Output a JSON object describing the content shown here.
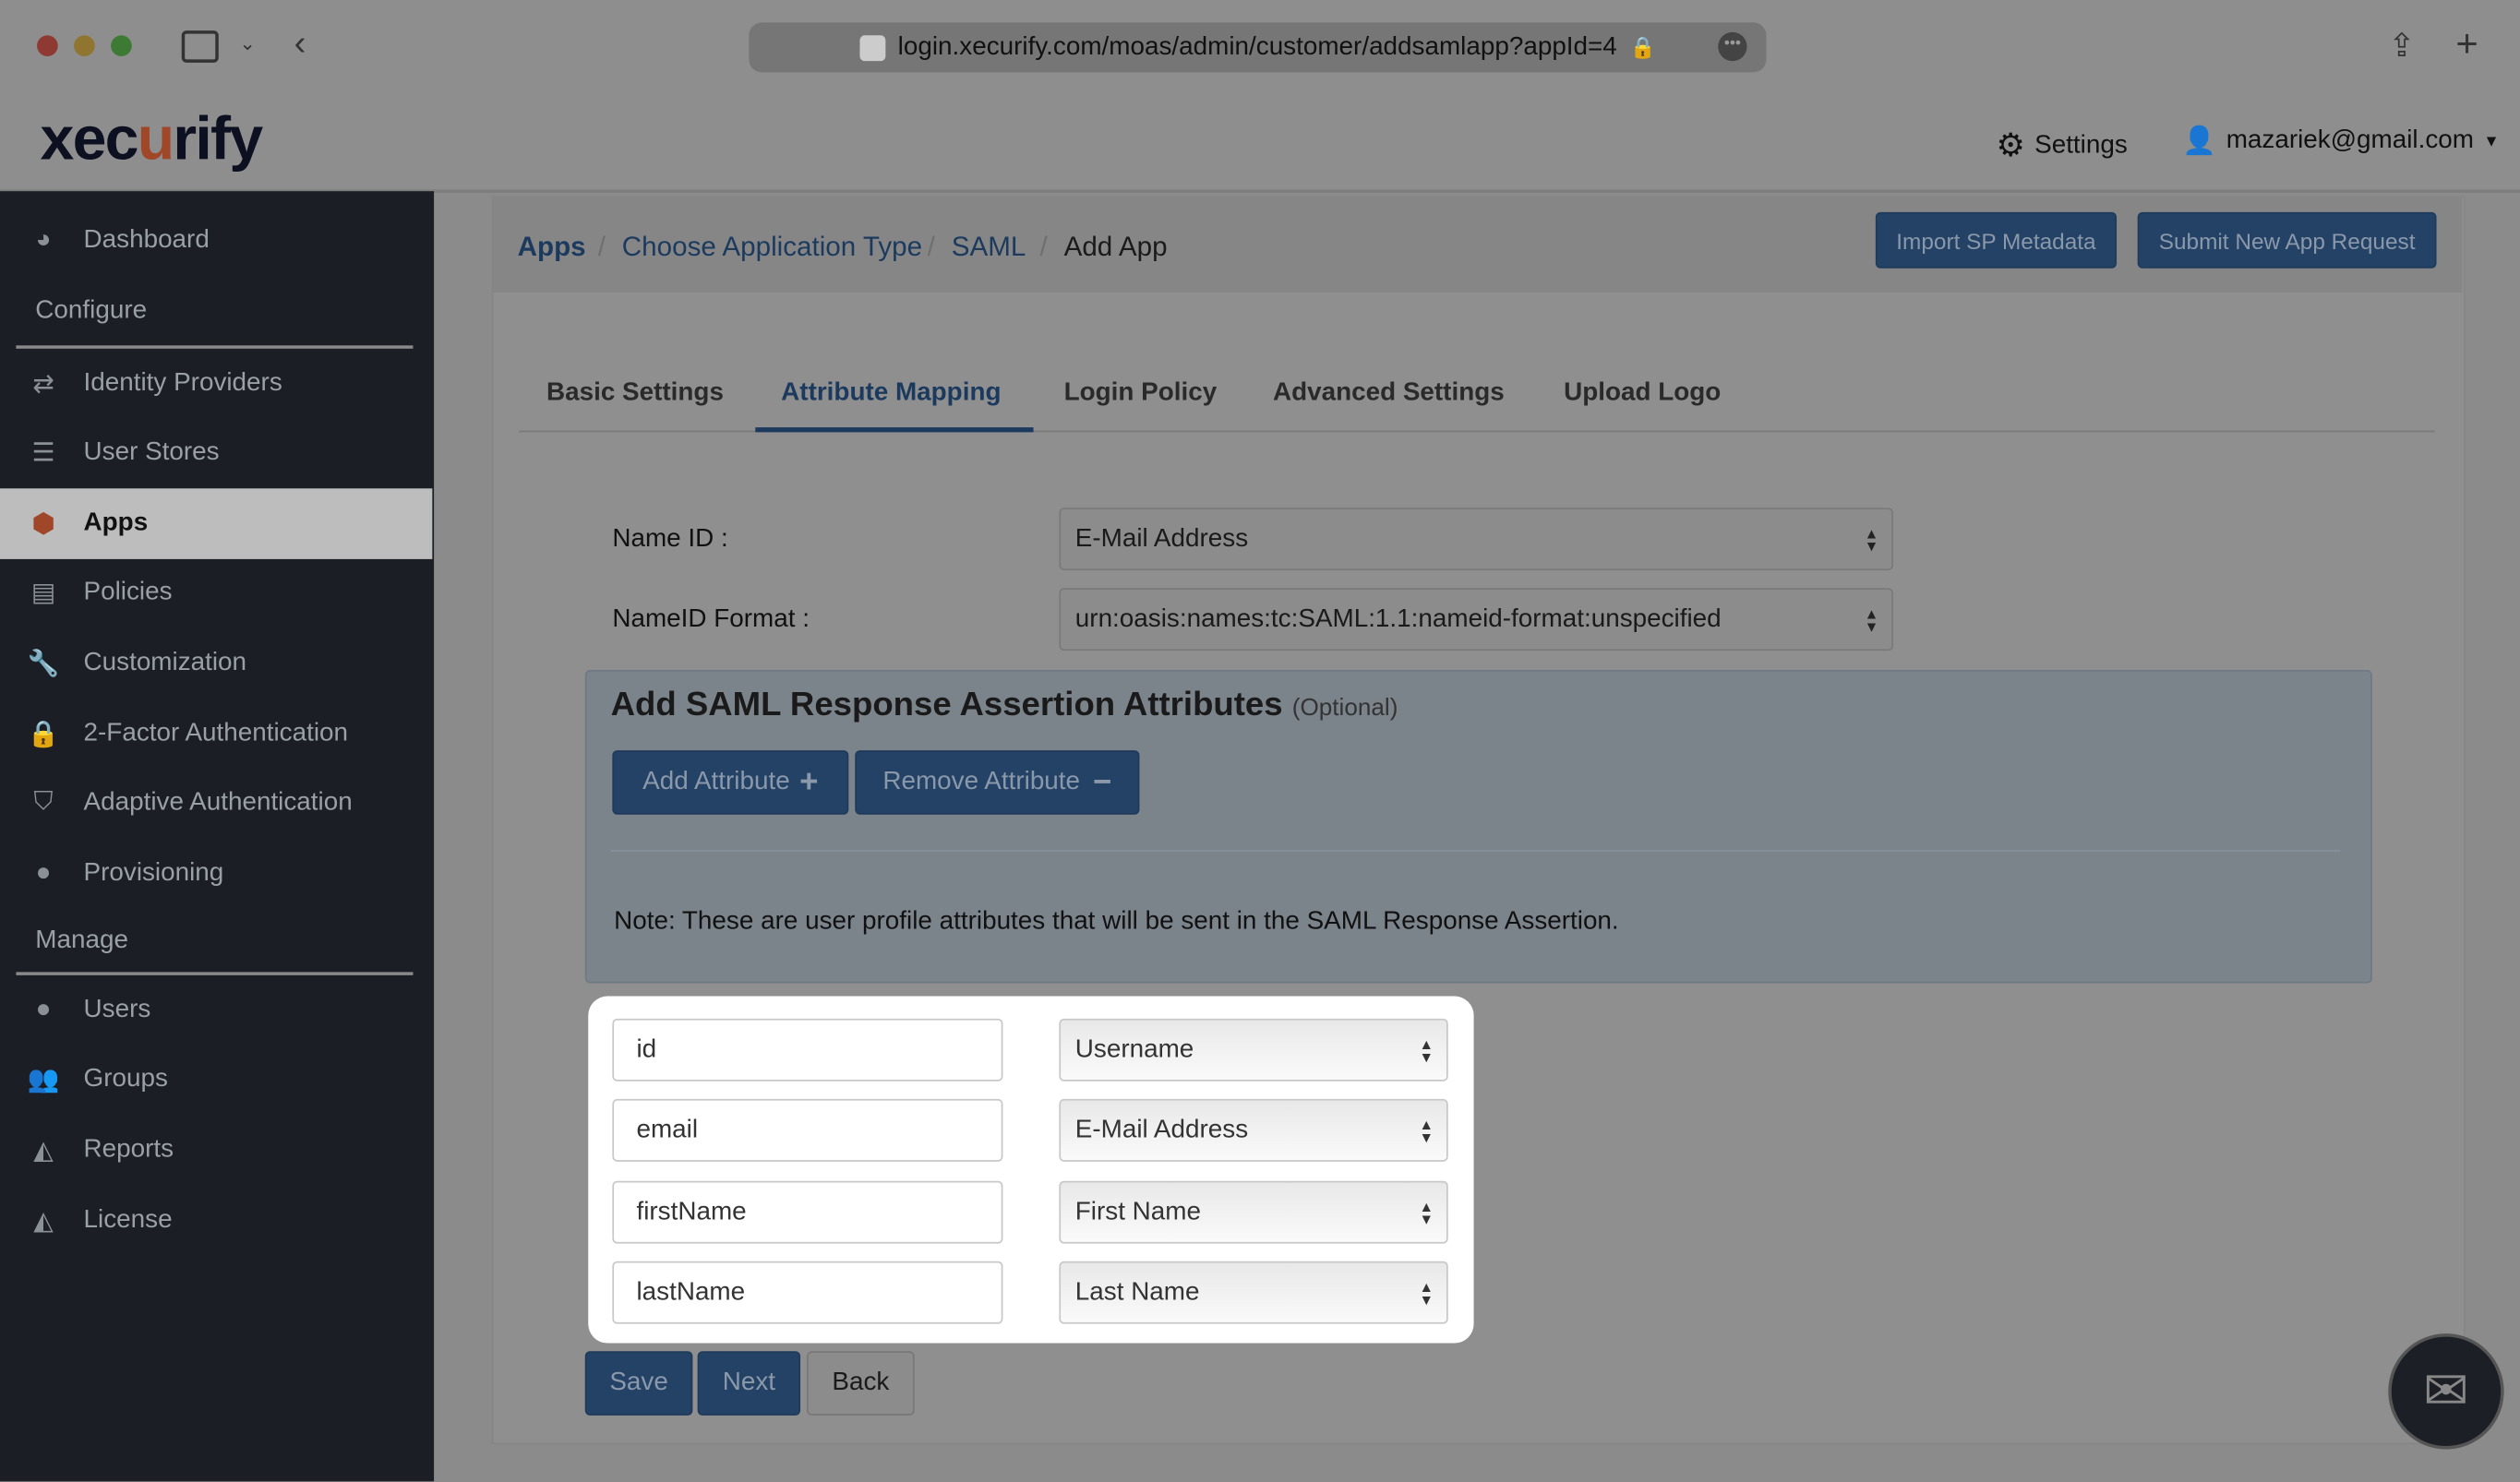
{
  "browser": {
    "url": "login.xecurify.com/moas/admin/customer/addsamlapp?appId=4"
  },
  "logo": {
    "pre": "xec",
    "mark": "u",
    "post": "rify"
  },
  "header": {
    "settings": "Settings",
    "user": "mazariek@gmail.com"
  },
  "sidebar": {
    "top": [
      {
        "label": "Dashboard",
        "icon": "dashboard-icon"
      }
    ],
    "configure_label": "Configure",
    "configure": [
      {
        "label": "Identity Providers"
      },
      {
        "label": "User Stores"
      },
      {
        "label": "Apps"
      },
      {
        "label": "Policies"
      },
      {
        "label": "Customization"
      },
      {
        "label": "2-Factor Authentication"
      },
      {
        "label": "Adaptive Authentication"
      },
      {
        "label": "Provisioning"
      }
    ],
    "manage_label": "Manage",
    "manage": [
      {
        "label": "Users"
      },
      {
        "label": "Groups"
      },
      {
        "label": "Reports"
      },
      {
        "label": "License"
      }
    ]
  },
  "breadcrumb": [
    "Apps",
    "Choose Application Type",
    "SAML",
    "Add App"
  ],
  "actions": {
    "import": "Import SP Metadata",
    "submit": "Submit New App Request"
  },
  "tabs": [
    "Basic Settings",
    "Attribute Mapping",
    "Login Policy",
    "Advanced Settings",
    "Upload Logo"
  ],
  "form": {
    "nameid_label": "Name ID :",
    "nameid_value": "E-Mail Address",
    "format_label": "NameID Format :",
    "format_value": "urn:oasis:names:tc:SAML:1.1:nameid-format:unspecified"
  },
  "attributes": {
    "title": "Add SAML Response Assertion Attributes",
    "optional": "(Optional)",
    "add": "Add Attribute",
    "remove": "Remove Attribute",
    "note": "Note: These are user profile attributes that will be sent in the SAML Response Assertion.",
    "rows": [
      {
        "name": "id",
        "value": "Username"
      },
      {
        "name": "email",
        "value": "E-Mail Address"
      },
      {
        "name": "firstName",
        "value": "First Name"
      },
      {
        "name": "lastName",
        "value": "Last Name"
      }
    ]
  },
  "footer": {
    "save": "Save",
    "next": "Next",
    "back": "Back"
  }
}
